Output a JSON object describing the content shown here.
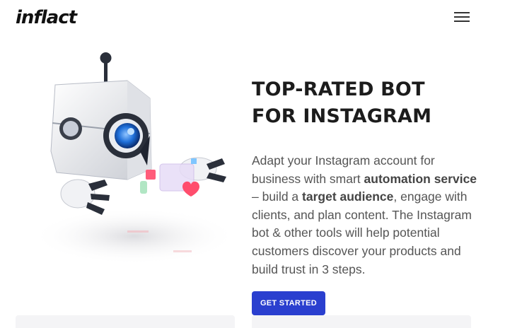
{
  "header": {
    "logo_text": "inflact",
    "menu_icon": "hamburger-menu-icon"
  },
  "hero": {
    "headline_line1": "TOP-RATED BOT",
    "headline_line2": "FOR INSTAGRAM",
    "description": {
      "part1": "Adapt your Instagram account for business with smart ",
      "bold1": "automation service",
      "part2": " – build a ",
      "bold2": "target audience",
      "part3": ", engage with clients, and plan content. The Instagram bot & other tools will help potential customers discover your products and build trust in 3 steps."
    },
    "cta_label": "GET STARTED",
    "illustration": "robot-bot-illustration"
  },
  "colors": {
    "accent": "#2a3fcf",
    "logo_spark": "#e8333d",
    "robot_eye": "#1e6fd9"
  }
}
